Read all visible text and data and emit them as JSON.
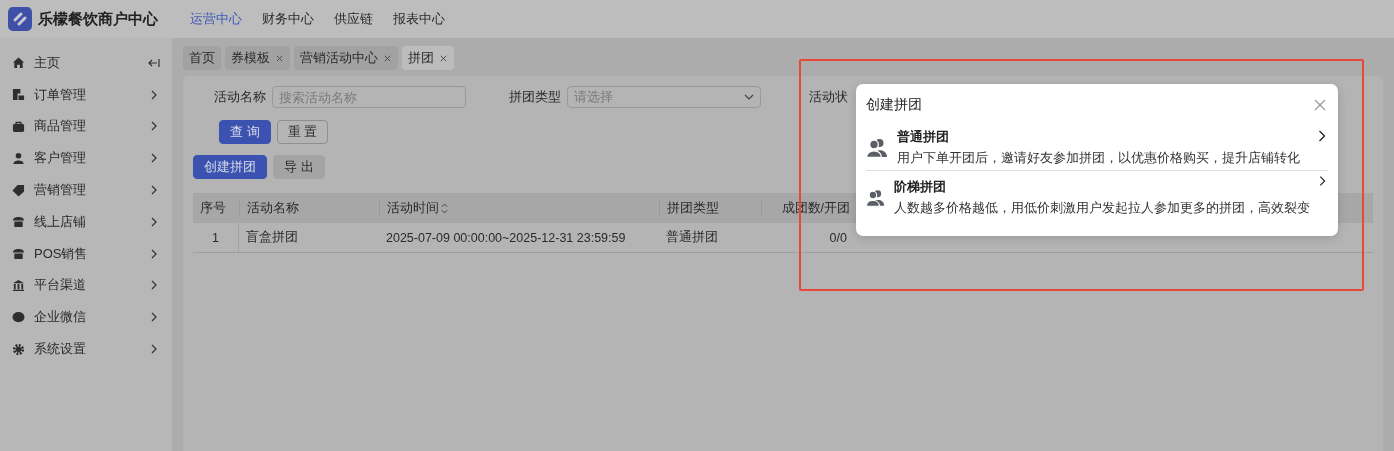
{
  "app": {
    "title": "乐檬餐饮商户中心"
  },
  "top_nav": [
    {
      "label": "运营中心",
      "selected": true
    },
    {
      "label": "财务中心",
      "selected": false
    },
    {
      "label": "供应链",
      "selected": false
    },
    {
      "label": "报表中心",
      "selected": false
    }
  ],
  "sidebar": {
    "items": [
      {
        "label": "主页",
        "kind": "home"
      },
      {
        "label": "订单管理",
        "kind": "menu"
      },
      {
        "label": "商品管理",
        "kind": "menu"
      },
      {
        "label": "客户管理",
        "kind": "menu"
      },
      {
        "label": "营销管理",
        "kind": "menu"
      },
      {
        "label": "线上店铺",
        "kind": "menu"
      },
      {
        "label": "POS销售",
        "kind": "menu"
      },
      {
        "label": "平台渠道",
        "kind": "menu"
      },
      {
        "label": "企业微信",
        "kind": "menu"
      },
      {
        "label": "系统设置",
        "kind": "menu"
      }
    ]
  },
  "tabs": [
    {
      "label": "首页",
      "closable": false,
      "selected": false
    },
    {
      "label": "券模板",
      "closable": true,
      "selected": false
    },
    {
      "label": "营销活动中心",
      "closable": true,
      "selected": false
    },
    {
      "label": "拼团",
      "closable": true,
      "selected": true
    }
  ],
  "filters": [
    {
      "label": "活动名称",
      "kind": "input",
      "placeholder": "搜索活动名称"
    },
    {
      "label": "拼团类型",
      "kind": "select",
      "placeholder": "请选择"
    },
    {
      "label": "活动状",
      "kind": "cut"
    }
  ],
  "filter_buttons": [
    {
      "label": "查 询",
      "kind": "primary"
    },
    {
      "label": "重 置",
      "kind": "default"
    }
  ],
  "actions": [
    {
      "label": "创建拼团",
      "kind": "primary"
    },
    {
      "label": "导 出",
      "kind": "gray"
    }
  ],
  "table": {
    "columns": [
      {
        "label": "序号",
        "sortable": false
      },
      {
        "label": "活动名称",
        "sortable": false
      },
      {
        "label": "活动时间",
        "sortable": true
      },
      {
        "label": "拼团类型",
        "sortable": false
      },
      {
        "label": "成团数/开团",
        "sortable": false
      }
    ],
    "rows": [
      {
        "cells": [
          "1",
          "盲盒拼团",
          "2025-07-09 00:00:00~2025-12-31 23:59:59",
          "普通拼团",
          "0/0"
        ]
      }
    ]
  },
  "dialog": {
    "title": "创建拼团",
    "options": [
      {
        "title": "普通拼团",
        "description": "用户下单开团后，邀请好友参加拼团，以优惠价格购买，提升店铺转化"
      },
      {
        "title": "阶梯拼团",
        "description": "人数越多价格越低，用低价刺激用户发起拉人参加更多的拼团，高效裂变"
      }
    ]
  }
}
